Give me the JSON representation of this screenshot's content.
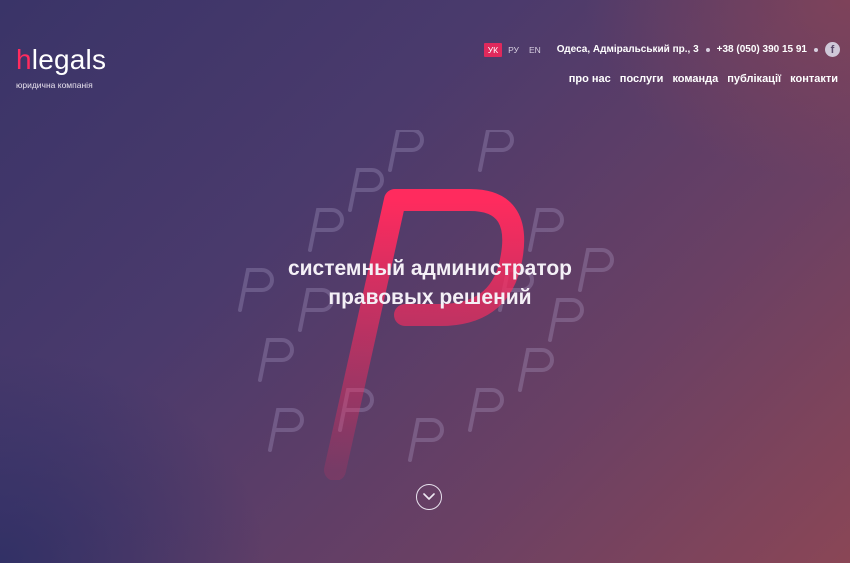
{
  "logo": {
    "mark_h": "h",
    "mark_rest": "legals",
    "subtitle": "юридична компанія"
  },
  "languages": [
    {
      "code": "УК",
      "active": true
    },
    {
      "code": "РУ",
      "active": false
    },
    {
      "code": "EN",
      "active": false
    }
  ],
  "contact": {
    "address": "Одеса, Адміральський пр., 3",
    "phone": "+38 (050) 390 15 91",
    "social_icon": "facebook-icon"
  },
  "nav": [
    "про нас",
    "послуги",
    "команда",
    "публікації",
    "контакти"
  ],
  "hero": {
    "line1": "системный администратор",
    "line2": "правовых решений"
  },
  "scroll_icon": "chevron-down-icon",
  "colors": {
    "accent": "#ff2b5e",
    "bg_start": "#3a3468",
    "bg_end": "#8a4656"
  }
}
